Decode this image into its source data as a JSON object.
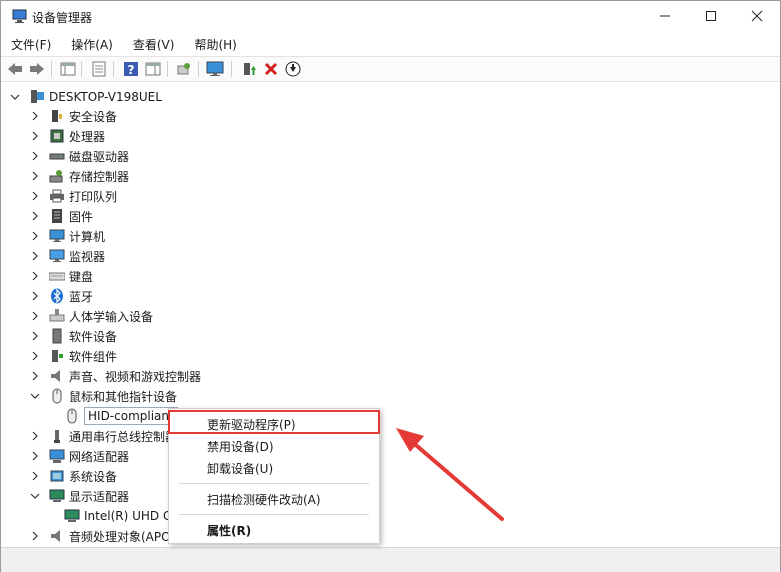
{
  "window": {
    "title": "设备管理器"
  },
  "menubar": [
    "文件(F)",
    "操作(A)",
    "查看(V)",
    "帮助(H)"
  ],
  "tree": {
    "root": "DESKTOP-V198UEL",
    "items": [
      {
        "label": "安全设备",
        "icon": "security-device-icon"
      },
      {
        "label": "处理器",
        "icon": "processor-icon"
      },
      {
        "label": "磁盘驱动器",
        "icon": "disk-drive-icon"
      },
      {
        "label": "存储控制器",
        "icon": "storage-controller-icon"
      },
      {
        "label": "打印队列",
        "icon": "printer-icon"
      },
      {
        "label": "固件",
        "icon": "firmware-icon"
      },
      {
        "label": "计算机",
        "icon": "computer-icon"
      },
      {
        "label": "监视器",
        "icon": "monitor-icon"
      },
      {
        "label": "键盘",
        "icon": "keyboard-icon"
      },
      {
        "label": "蓝牙",
        "icon": "bluetooth-icon"
      },
      {
        "label": "人体学输入设备",
        "icon": "hid-icon"
      },
      {
        "label": "软件设备",
        "icon": "software-device-icon"
      },
      {
        "label": "软件组件",
        "icon": "software-component-icon"
      },
      {
        "label": "声音、视频和游戏控制器",
        "icon": "speaker-icon"
      },
      {
        "label": "鼠标和其他指针设备",
        "icon": "mouse-icon",
        "expanded": true
      },
      {
        "label": "HID-compliant",
        "icon": "mouse-icon",
        "child": true,
        "selected": true
      },
      {
        "label": "通用串行总线控制器",
        "icon": "usb-icon"
      },
      {
        "label": "网络适配器",
        "icon": "network-icon"
      },
      {
        "label": "系统设备",
        "icon": "system-device-icon"
      },
      {
        "label": "显示适配器",
        "icon": "display-adapter-icon",
        "expanded": true
      },
      {
        "label": "Intel(R) UHD G",
        "icon": "display-adapter-icon",
        "child": true
      },
      {
        "label": "音频处理对象(APO)",
        "icon": "speaker-icon"
      }
    ]
  },
  "context_menu": {
    "items": [
      "更新驱动程序(P)",
      "禁用设备(D)",
      "卸载设备(U)",
      "扫描检测硬件改动(A)",
      "属性(R)"
    ]
  },
  "colors": {
    "highlight": "#e53935",
    "accent": "#1e6fd0"
  }
}
